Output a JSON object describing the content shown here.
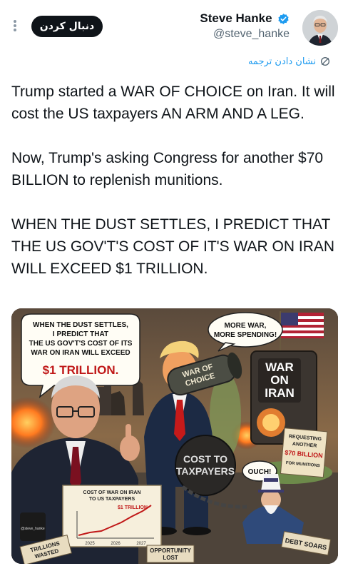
{
  "header": {
    "follow_label": "دنبال کردن",
    "display_name": "Steve Hanke",
    "handle": "@steve_hanke",
    "accent_color": "#1d9bf0"
  },
  "translate": {
    "label": "نشان دادن ترجمه"
  },
  "tweet": {
    "paragraphs": [
      "Trump started a WAR OF CHOICE on Iran. It will cost the US taxpayers AN ARM AND A LEG.",
      "Now, Trump's asking Congress for another $70 BILLION to replenish munitions.",
      "WHEN THE DUST SETTLES, I PREDICT THAT THE US GOV'T'S COST OF IT'S WAR ON IRAN WILL EXCEED $1 TRILLION."
    ]
  },
  "image": {
    "bubble_left": {
      "line1": "WHEN THE DUST SETTLES,",
      "line2": "I PREDICT THAT",
      "line3": "THE US GOV'T'S COST OF ITS",
      "line4": "WAR ON IRAN WILL EXCEED",
      "amount": "$1 TRILLION."
    },
    "bubble_top": {
      "line1": "MORE WAR,",
      "line2": "MORE SPENDING!"
    },
    "barrel_label": {
      "line1": "WAR OF",
      "line2": "CHOICE"
    },
    "machine_label": {
      "line1": "WAR",
      "line2": "ON",
      "line3": "IRAN"
    },
    "ball_label": {
      "line1": "COST TO",
      "line2": "TAXPAYERS"
    },
    "ouch": "OUCH!",
    "request_sign": {
      "line1": "REQUESTING",
      "line2": "ANOTHER",
      "line3": "$70 BILLION",
      "line4": "FOR MUNITIONS"
    },
    "chart_sign": {
      "title1": "COST OF WAR ON IRAN",
      "title2": "TO US TAXPAYERS",
      "peak": "$1 TRILLION",
      "years": [
        "2025",
        "2026",
        "2027"
      ]
    },
    "mug_label": "@steve_hanke",
    "trillions_sign": {
      "line1": "TRILLIONS",
      "line2": "WASTED"
    },
    "opportunity_sign": {
      "line1": "OPPORTUNITY",
      "line2": "LOST"
    },
    "debt_sign": "DEBT SOARS"
  }
}
